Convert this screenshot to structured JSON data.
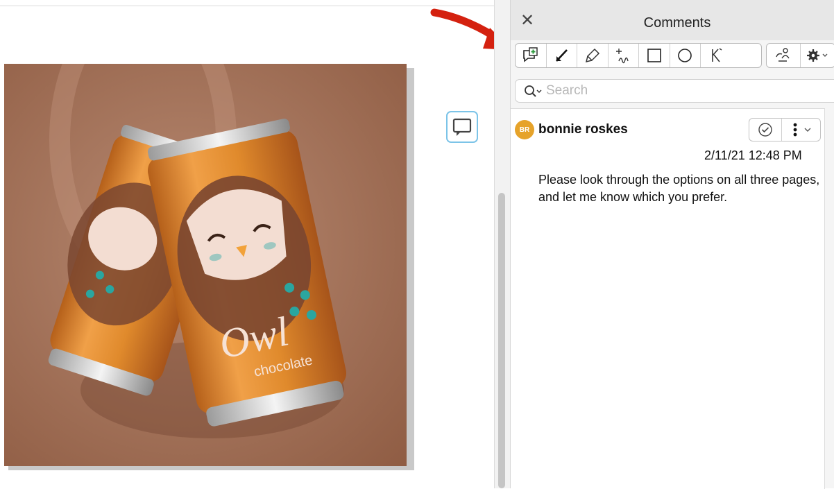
{
  "panel": {
    "title": "Comments",
    "close_label": "✕",
    "tools": [
      {
        "icon": "add-comment-icon"
      },
      {
        "icon": "line-arrow-icon"
      },
      {
        "icon": "highlighter-icon"
      },
      {
        "icon": "freehand-icon"
      },
      {
        "icon": "rectangle-icon"
      },
      {
        "icon": "ellipse-icon"
      },
      {
        "icon": "text-pen-icon"
      }
    ],
    "extra_tools": [
      {
        "icon": "share-user-icon"
      },
      {
        "icon": "gear-icon"
      }
    ],
    "search": {
      "placeholder": "Search",
      "value": ""
    }
  },
  "comment": {
    "initials": "BR",
    "author": "bonnie roskes",
    "timestamp": "2/11/21 12:48 PM",
    "text": "Please look through the options on all three pages, and let me know which you prefer."
  },
  "artwork": {
    "brand": "Owl",
    "flavor": "chocolate"
  },
  "colors": {
    "avatar": "#e6a32a",
    "annotation_arrow": "#d4210f",
    "background": "#b27b5d",
    "can": "#e0892c"
  }
}
